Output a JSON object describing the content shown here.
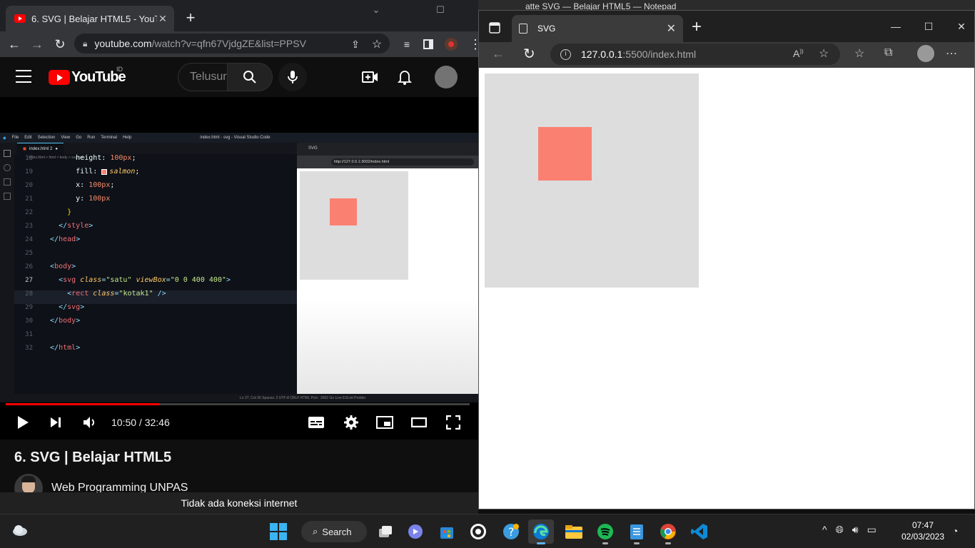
{
  "chrome": {
    "tab_title": "6. SVG | Belajar HTML5 - YouTube",
    "url_host": "youtube.com",
    "url_path": "/watch?v=qfn67VjdgZE&list=PPSV"
  },
  "youtube": {
    "logo_text": "YouTube",
    "region": "ID",
    "search_placeholder": "Telusuri",
    "video_title": "6. SVG | Belajar HTML5",
    "channel": "Web Programming UNPAS",
    "time": "10:50 / 32:46",
    "progress": 0.333,
    "offline_notice": "Tidak ada koneksi internet"
  },
  "vscode": {
    "menu": [
      "File",
      "Edit",
      "Selection",
      "View",
      "Go",
      "Run",
      "Terminal",
      "Help"
    ],
    "window_title": "index.html - svg - Visual Studio Code",
    "tab": "index.html 2",
    "breadcrumb": "index.html > html > body > svg.satu",
    "preview_tab": "SVG",
    "preview_url": "http://127.0.0.1:3002/index.html",
    "status": "Ln 27, Col 36   Spaces: 2   UTF-8   CRLF   HTML   Port : 3002   Go Live   ESLint   Prettier"
  },
  "edge": {
    "behind_window_title": "atte SVG — Belajar HTML5 — Notepad",
    "tab_title": "SVG",
    "url_host": "127.0.0.1",
    "url_path": ":5500/index.html"
  },
  "colors": {
    "svg_background": "#dddddd",
    "rect_fill": "#fa8072",
    "youtube_red": "#ff0000"
  },
  "taskbar": {
    "search_label": "Search",
    "time": "07:47",
    "date": "02/03/2023"
  }
}
